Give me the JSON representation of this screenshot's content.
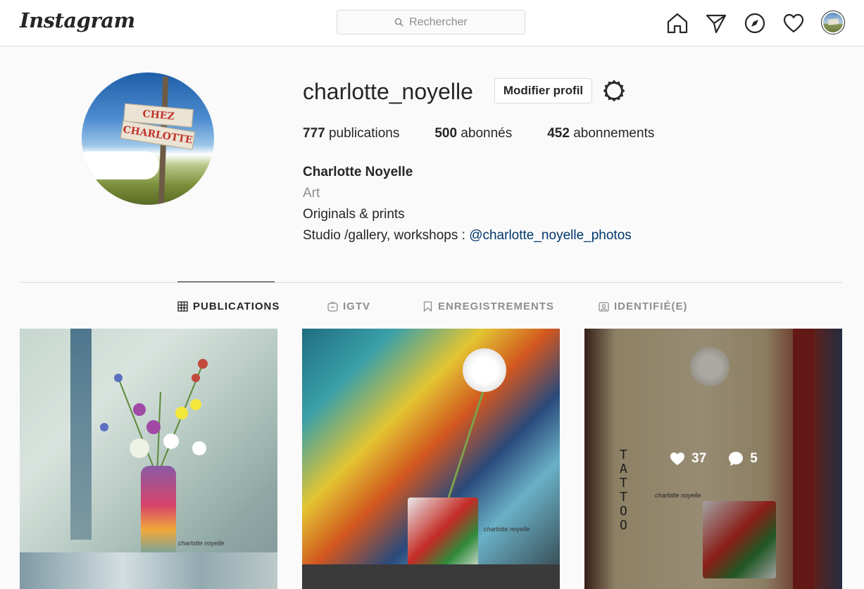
{
  "navbar": {
    "logo_text": "Instagram",
    "search_placeholder": "Rechercher",
    "icons": [
      "home-icon",
      "direct-icon",
      "explore-icon",
      "activity-icon",
      "profile-avatar"
    ]
  },
  "profile": {
    "username": "charlotte_noyelle",
    "edit_button": "Modifier profil",
    "stats": {
      "posts_count": "777",
      "posts_label": "publications",
      "followers_count": "500",
      "followers_label": "abonnés",
      "following_count": "452",
      "following_label": "abonnements"
    },
    "bio": {
      "full_name": "Charlotte Noyelle",
      "category": "Art",
      "line1": "Originals & prints",
      "line2_prefix": "Studio /gallery, workshops : ",
      "line2_link": "@charlotte_noyelle_photos"
    },
    "avatar_sign": [
      "CHEZ",
      "CHARLOTTE"
    ]
  },
  "tabs": [
    {
      "label": "PUBLICATIONS",
      "icon": "grid-icon",
      "active": true
    },
    {
      "label": "IGTV",
      "icon": "igtv-icon",
      "active": false
    },
    {
      "label": "ENREGISTREMENTS",
      "icon": "bookmark-icon",
      "active": false
    },
    {
      "label": "IDENTIFIÉ(E)",
      "icon": "tagged-icon",
      "active": false
    }
  ],
  "posts": [
    {
      "watermark": "charlotte noyelle"
    },
    {
      "watermark": "charlotte noyelle"
    },
    {
      "watermark": "charlotte noyelle",
      "tattoo_text": "TATTOO",
      "likes": "37",
      "comments": "5"
    }
  ],
  "colors": {
    "text": "#262626",
    "muted": "#8e8e8e",
    "link": "#00376b",
    "border": "#dbdbdb",
    "background": "#fafafa"
  }
}
